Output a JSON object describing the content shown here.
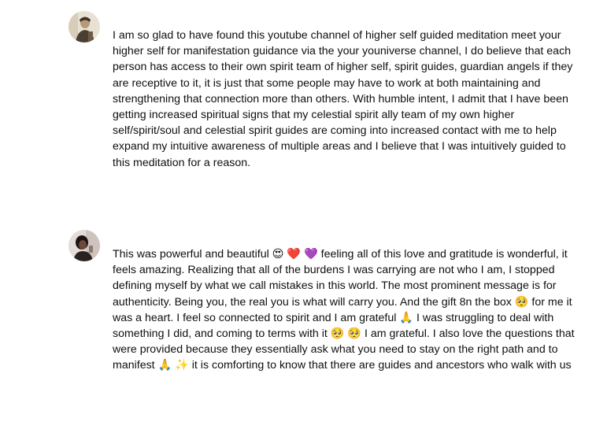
{
  "comments": [
    {
      "text": "I am so glad to have found this youtube channel of higher self guided meditation meet your higher self for manifestation guidance via  the your youniverse channel, I do believe that each person has access to their own spirit team of higher self, spirit guides, guardian angels if they are receptive to it, it is just that some people may have to work at both maintaining and strengthening that connection more than others. With humble intent, I admit that I have been getting increased spiritual signs that my celestial spirit ally team of my own higher self/spirit/soul and celestial spirit guides are coming into increased contact with me to help expand my intuitive awareness of multiple areas and I believe that I was intuitively guided to this meditation for a reason.",
      "avatar_colors": [
        "#3a3128",
        "#c9b49a",
        "#e8dcc8"
      ]
    },
    {
      "text": "This was powerful and beautiful 😍 ❤️ 💜 feeling all of this love and gratitude is wonderful, it feels amazing. Realizing that all of the burdens I was carrying are not who I am, I stopped defining myself by what we call mistakes in this world. The most prominent message is for authenticity. Being you, the real you is what will carry you. And the gift 8n the box 🥺 for me it was a heart. I feel so connected to spirit and I am grateful 🙏 I was struggling to deal with something I did, and coming to terms with it 🥺 🥺 I am grateful. I also love the questions that were provided because they essentially ask what you need to stay on the right path and to manifest 🙏 ✨ it is comforting to know that there are guides and ancestors who walk with us",
      "avatar_colors": [
        "#1a1414",
        "#6b4a3a",
        "#d7c9c4"
      ]
    }
  ]
}
